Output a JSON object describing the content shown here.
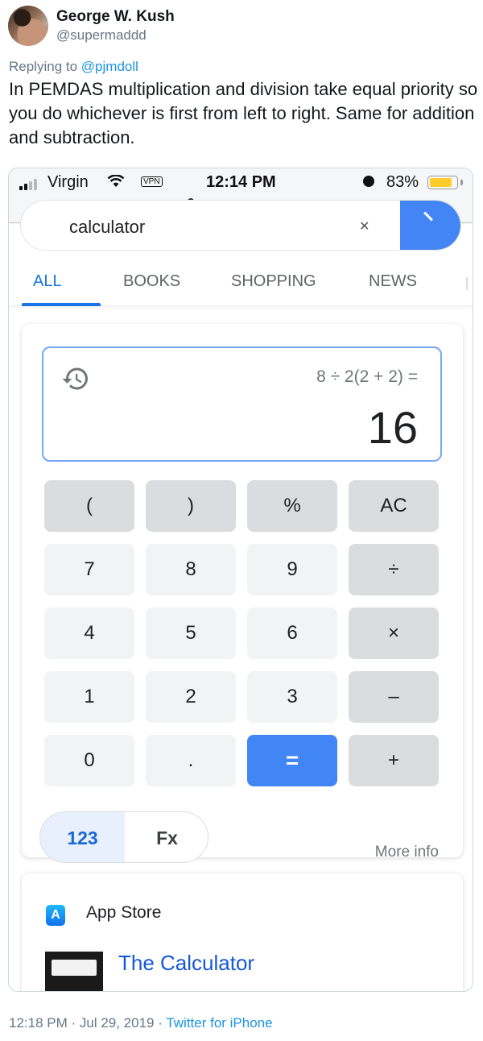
{
  "tweet": {
    "author_name": "George W. Kush",
    "author_handle": "@supermaddd",
    "replying_prefix": "Replying to",
    "replying_handle": "@pjmdoll",
    "text": "In PEMDAS multiplication and division take equal priority so you do whichever is first from left to right. Same for addition and subtraction.",
    "timestamp": "12:18 PM · Jul 29, 2019 · ",
    "source": "Twitter for iPhone"
  },
  "phone": {
    "status_bar": {
      "carrier": "Virgin",
      "vpn": "VPN",
      "time": "12:14 PM",
      "battery_percent_label": "83%",
      "battery_level": 0.83,
      "battery_color": "#ffcc29"
    },
    "url": "google.com",
    "search": {
      "query": "calculator",
      "clear_icon": "clear-icon",
      "search_icon": "search-icon"
    },
    "tabs": [
      {
        "label": "ALL",
        "active": true
      },
      {
        "label": "BOOKS",
        "active": false
      },
      {
        "label": "SHOPPING",
        "active": false
      },
      {
        "label": "NEWS",
        "active": false
      }
    ],
    "calculator": {
      "expression": "8 ÷ 2(2 + 2) =",
      "result": "16",
      "keys": [
        [
          "(",
          ")",
          "%",
          "AC"
        ],
        [
          "7",
          "8",
          "9",
          "÷"
        ],
        [
          "4",
          "5",
          "6",
          "×"
        ],
        [
          "1",
          "2",
          "3",
          "–"
        ],
        [
          "0",
          ".",
          "=",
          "+"
        ]
      ],
      "mode_numeric": "123",
      "mode_functions": "Fx",
      "more_info": "More info",
      "accent_color": "#4285f4"
    },
    "app_result": {
      "store_label": "App Store",
      "title": "The Calculator"
    }
  }
}
